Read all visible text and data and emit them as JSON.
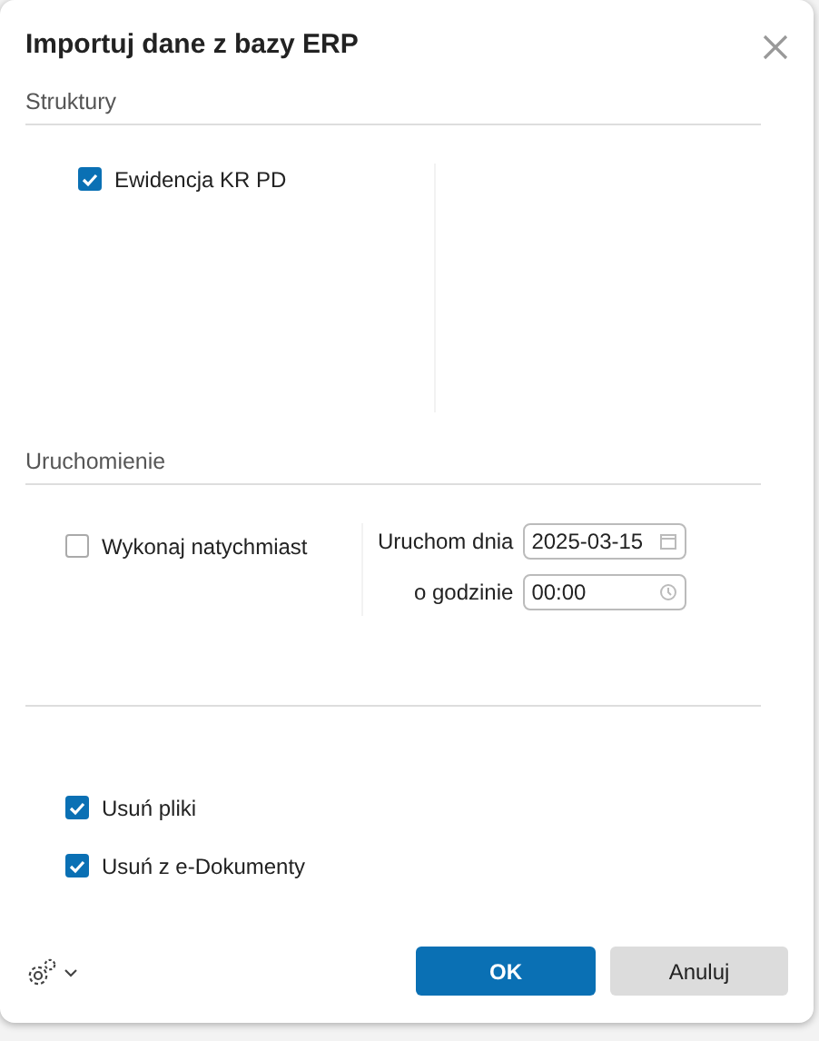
{
  "dialog": {
    "title": "Importuj dane z bazy ERP"
  },
  "structures": {
    "heading": "Struktury",
    "items": [
      {
        "label": "Ewidencja KR PD",
        "checked": true
      }
    ]
  },
  "launch": {
    "heading": "Uruchomienie",
    "immediate": {
      "label": "Wykonaj natychmiast",
      "checked": false
    },
    "fields": [
      {
        "kind": "date",
        "label": "Uruchom dnia",
        "value": "2025-03-15"
      },
      {
        "kind": "time",
        "label": "o godzinie",
        "value": "00:00"
      }
    ]
  },
  "options": [
    {
      "label": "Usuń pliki",
      "checked": true
    },
    {
      "label": "Usuń z e-Dokumenty",
      "checked": true
    }
  ],
  "buttons": [
    {
      "label": "OK",
      "kind": "primary"
    },
    {
      "label": "Anuluj",
      "kind": "secondary"
    }
  ]
}
